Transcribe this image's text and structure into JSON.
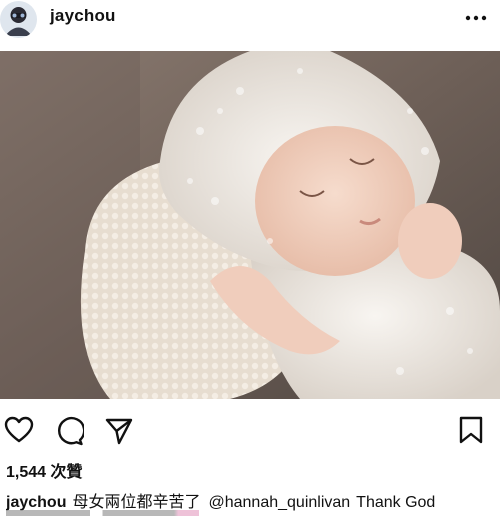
{
  "post": {
    "username": "jaychou",
    "likes_text": "1,544 次贊",
    "caption": {
      "username": "jaychou",
      "text": "母女兩位都辛苦了",
      "mention": "@hannah_quinlivan",
      "text_after": "Thank God"
    }
  },
  "icons": {
    "avatar": "avatar",
    "more": "more-options-icon",
    "like": "heart-icon",
    "comment": "comment-icon",
    "share": "share-icon",
    "save": "bookmark-icon"
  },
  "colors": {
    "text": "#111111",
    "background": "#ffffff"
  }
}
